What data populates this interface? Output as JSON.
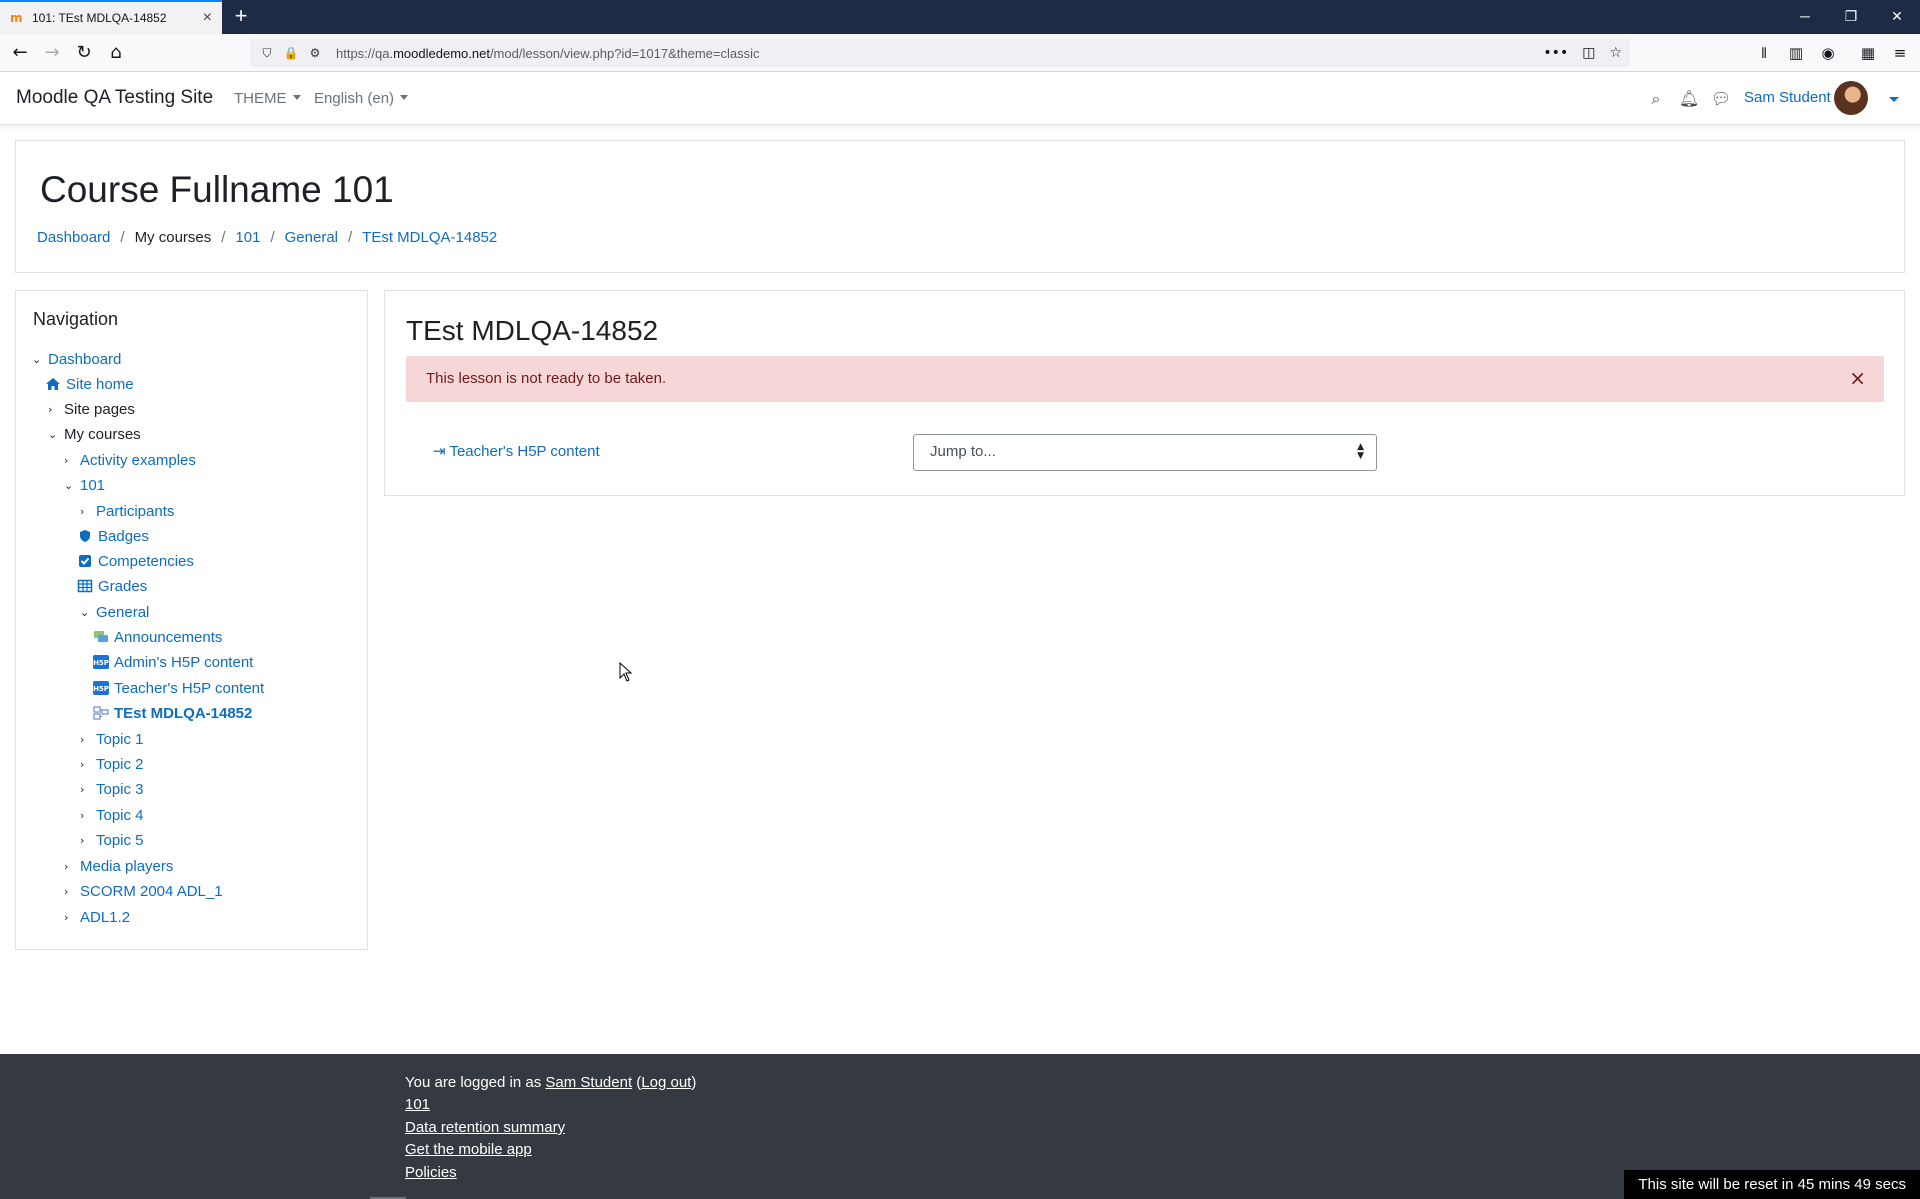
{
  "browser": {
    "tab_title": "101: TEst MDLQA-14852",
    "tab_favicon": "m",
    "new_tab": "+",
    "url_prefix": "https://qa.",
    "url_host": "moodledemo.net",
    "url_path": "/mod/lesson/view.php?id=1017&theme=classic"
  },
  "header": {
    "site_name": "Moodle QA Testing Site",
    "theme_menu": "THEME",
    "language_menu": "English (en)",
    "user_name": "Sam Student"
  },
  "page": {
    "course_title": "Course Fullname 101",
    "breadcrumb": [
      "Dashboard",
      "My courses",
      "101",
      "General",
      "TEst MDLQA-14852"
    ]
  },
  "navigation": {
    "title": "Navigation",
    "items": [
      {
        "label": "Dashboard"
      },
      {
        "label": "Site home"
      },
      {
        "label": "Site pages"
      },
      {
        "label": "My courses"
      },
      {
        "label": "Activity examples"
      },
      {
        "label": "101"
      },
      {
        "label": "Participants"
      },
      {
        "label": "Badges"
      },
      {
        "label": "Competencies"
      },
      {
        "label": "Grades"
      },
      {
        "label": "General"
      },
      {
        "label": "Announcements"
      },
      {
        "label": "Admin's H5P content"
      },
      {
        "label": "Teacher's H5P content"
      },
      {
        "label": "TEst MDLQA-14852"
      },
      {
        "label": "Topic 1"
      },
      {
        "label": "Topic 2"
      },
      {
        "label": "Topic 3"
      },
      {
        "label": "Topic 4"
      },
      {
        "label": "Topic 5"
      },
      {
        "label": "Media players"
      },
      {
        "label": "SCORM 2004 ADL_1"
      },
      {
        "label": "ADL1.2"
      }
    ]
  },
  "main": {
    "lesson_title": "TEst MDLQA-14852",
    "alert_text": "This lesson is not ready to be taken.",
    "prev_activity_link": "⇥ Teacher's H5P content",
    "jump_select_value": "Jump to..."
  },
  "footer": {
    "logged_in_prefix": "You are logged in as ",
    "logged_in_user": "Sam Student",
    "logout_open": " (",
    "logout_label": "Log out",
    "logout_close": ")",
    "course_link": "101",
    "data_retention": "Data retention summary",
    "mobile_app": "Get the mobile app",
    "policies": "Policies",
    "reset_notice": "This site will be reset in 45 mins 49 secs"
  },
  "colors": {
    "link": "#0f6cbf",
    "alert_bg": "#f7d6d7",
    "footer_bg": "#343a40"
  }
}
